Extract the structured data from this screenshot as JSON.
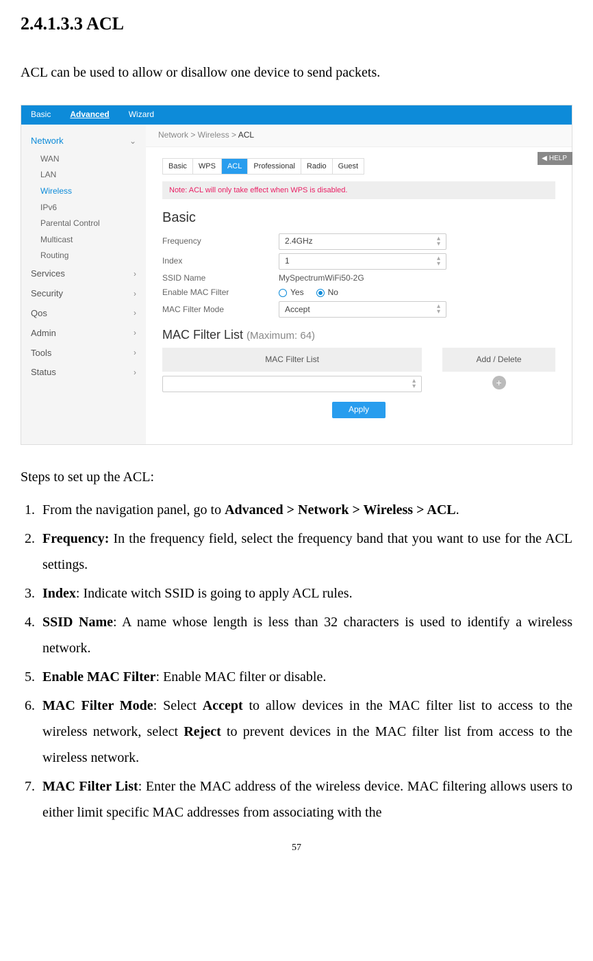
{
  "doc": {
    "heading": "2.4.1.3.3 ACL",
    "intro": "ACL can be used to allow or disallow one device to send packets.",
    "steps_intro": "Steps to set up the ACL:",
    "page_number": "57",
    "steps": {
      "s1a": "From the navigation panel, go to ",
      "s1b": "Advanced > Network > Wireless > ACL",
      "s1c": ".",
      "s2a": "Frequency:",
      "s2b": " In the frequency field, select the frequency band that you want to use for the ACL settings.",
      "s3a": "Index",
      "s3b": ":    Indicate witch SSID is going to apply ACL rules.",
      "s4a": "SSID Name",
      "s4b": ": A name whose length is less than 32 characters is used to identify a wireless network.",
      "s5a": "Enable MAC Filter",
      "s5b": ": Enable MAC filter or disable.",
      "s6a": "MAC  Filter  Mode",
      "s6b": ":  Select  ",
      "s6c": "Accept",
      "s6d": "  to  allow  devices  in  the  MAC  filter  list  to access to the wireless network, select ",
      "s6e": "Reject",
      "s6f": " to prevent devices in the MAC filter list from access to the wireless network.",
      "s7a": "MAC Filter List",
      "s7b": ": Enter the MAC address of the wireless device. MAC filtering allows  users  to  either  limit  specific  MAC  addresses  from  associating  with  the"
    }
  },
  "ui": {
    "top_tabs": {
      "basic": "Basic",
      "advanced": "Advanced",
      "wizard": "Wizard"
    },
    "breadcrumb": {
      "prefix": "Network > Wireless > ",
      "current": "ACL"
    },
    "sidebar": {
      "network": "Network",
      "wan": "WAN",
      "lan": "LAN",
      "wireless": "Wireless",
      "ipv6": "IPv6",
      "parental": "Parental Control",
      "multicast": "Multicast",
      "routing": "Routing",
      "services": "Services",
      "security": "Security",
      "qos": "Qos",
      "admin": "Admin",
      "tools": "Tools",
      "status": "Status"
    },
    "inner_tabs": {
      "basic": "Basic",
      "wps": "WPS",
      "acl": "ACL",
      "professional": "Professional",
      "radio": "Radio",
      "guest": "Guest"
    },
    "help": "HELP",
    "note": "Note: ACL will only take effect when WPS is disabled.",
    "panel_title": "Basic",
    "labels": {
      "frequency": "Frequency",
      "index": "Index",
      "ssid": "SSID Name",
      "enable_mac": "Enable MAC Filter",
      "mac_mode": "MAC Filter Mode"
    },
    "values": {
      "frequency": "2.4GHz",
      "index": "1",
      "ssid": "MySpectrumWiFi50-2G",
      "yes": "Yes",
      "no": "No",
      "mac_mode": "Accept"
    },
    "mac_filter": {
      "title": "MAC Filter List ",
      "title_suffix": "(Maximum: 64)",
      "col1": "MAC Filter List",
      "col2": "Add / Delete"
    },
    "apply": "Apply"
  }
}
